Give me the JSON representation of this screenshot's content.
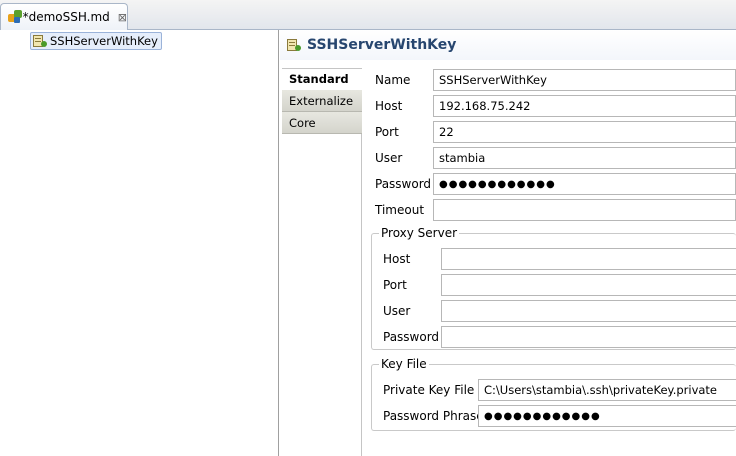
{
  "editor_tab": {
    "title": "*demoSSH.md",
    "close_glyph": "⊠"
  },
  "tree": {
    "items": [
      {
        "label": "SSHServerWithKey",
        "icon": "ssh-server-icon"
      }
    ]
  },
  "properties": {
    "title": "SSHServerWithKey",
    "side_tabs": [
      {
        "label": "Standard",
        "active": true
      },
      {
        "label": "Externalize",
        "active": false
      },
      {
        "label": "Core",
        "active": false
      }
    ],
    "fields": {
      "name": {
        "label": "Name",
        "value": "SSHServerWithKey"
      },
      "host": {
        "label": "Host",
        "value": "192.168.75.242"
      },
      "port": {
        "label": "Port",
        "value": "22"
      },
      "user": {
        "label": "User",
        "value": "stambia"
      },
      "password": {
        "label": "Password",
        "value": "●●●●●●●●●●●●"
      },
      "timeout": {
        "label": "Timeout",
        "value": ""
      }
    },
    "proxy_server": {
      "legend": "Proxy Server",
      "host": {
        "label": "Host",
        "value": ""
      },
      "port": {
        "label": "Port",
        "value": ""
      },
      "user": {
        "label": "User",
        "value": ""
      },
      "password": {
        "label": "Password",
        "value": ""
      }
    },
    "key_file": {
      "legend": "Key File",
      "private_key_file": {
        "label": "Private Key File",
        "value": "C:\\Users\\stambia\\.ssh\\privateKey.private"
      },
      "password_phrase": {
        "label": "Password Phrase",
        "value": "●●●●●●●●●●●●"
      }
    }
  }
}
